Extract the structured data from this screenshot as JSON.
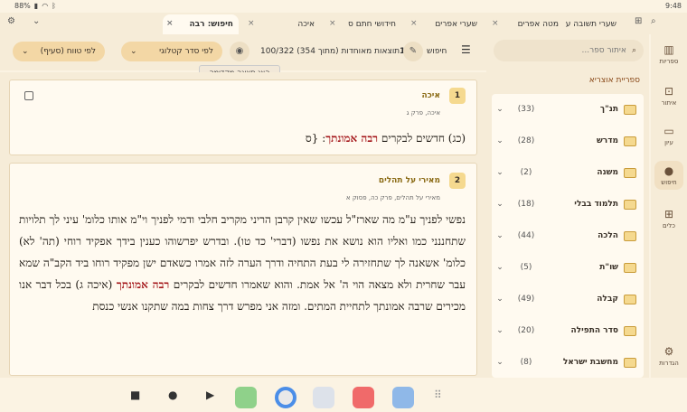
{
  "status": {
    "battery": "88%",
    "time": "9:48"
  },
  "tabs": [
    {
      "label": "חיפוש: רבה",
      "active": true
    },
    {
      "label": "איכה",
      "active": false
    },
    {
      "label": "חידושי חתם ס",
      "active": false
    },
    {
      "label": "שערי אפרים",
      "active": false
    },
    {
      "label": "מטה אפרים",
      "active": false
    },
    {
      "label": "שערי תשובה ע\"ו",
      "active": false
    }
  ],
  "rail": [
    {
      "label": "ספריות",
      "icon": "library-icon"
    },
    {
      "label": "איתור",
      "icon": "locate-icon"
    },
    {
      "label": "עיון",
      "icon": "book-icon"
    },
    {
      "label": "חיפוש",
      "icon": "search-icon",
      "active": true
    },
    {
      "label": "כלים",
      "icon": "tools-icon"
    },
    {
      "label": "הגדרות",
      "icon": "settings-icon"
    }
  ],
  "library": {
    "search_placeholder": "איתור ספר...",
    "title": "ספריית אוצריא",
    "categories": [
      {
        "name": "תנ\"ך",
        "count": "(33)"
      },
      {
        "name": "מדרש",
        "count": "(28)"
      },
      {
        "name": "משנה",
        "count": "(2)"
      },
      {
        "name": "תלמוד בבלי",
        "count": "(18)"
      },
      {
        "name": "הלכה",
        "count": "(44)"
      },
      {
        "name": "שו\"ת",
        "count": "(5)"
      },
      {
        "name": "קבלה",
        "count": "(49)"
      },
      {
        "name": "סדר התפילה",
        "count": "(20)"
      },
      {
        "name": "מחשבת ישראל",
        "count": "(8)"
      }
    ]
  },
  "toolbar": {
    "search_label": "חיפוש",
    "results_summary": "100/322 תוצאות מאוחדות (מתוך 354)",
    "order_button": "לפי סדר קטלוגי",
    "range_button": "לפי טווח (סעיף)",
    "tooltip": "הצג תצוגה מקדימה",
    "cursor_digit": "1"
  },
  "results": [
    {
      "num": "1",
      "title": "איכה",
      "ref": "איכה, פרק ג",
      "before": "(כג) חדשים לבקרים ",
      "highlight": "רבה אמונתך",
      "after": ": {ס"
    },
    {
      "num": "2",
      "title": "מאירי על תהלים",
      "ref": "מאירי על תהלים, פרק כה, פסוק א",
      "before": "נפשי לפניך ע\"מ מה שארז\"ל עכשו שאין קרבן הריני מקריב חלבי ודמי לפניך וי\"מ אותו כלומ' עיני לך תלויות שתחננני כמו ואליו הוא נושא את נפשו (דברי' כד טו). ובדרש יפרשוהו כענין בידך אפקיד רוחי (תה' לא) כלומ' אשאנה לך שתחזירה לי בעת התחיה ודרך הערה לזה אמרו כשאדם ישן מפקיד רוחו ביד הקב\"ה שמא עבר שחרית ולא מצאה הוי ה' אל אמת. והוא שאמרו חדשים לבקרים ",
      "highlight": "רבה אמונתך",
      "after": " (איכה ג) בכל דבר אנו מכירים שרבה אמונתך לתחיית המתים. ומזה אני מפרש דרך צחות במה שתקנו אנשי כנסת"
    }
  ]
}
